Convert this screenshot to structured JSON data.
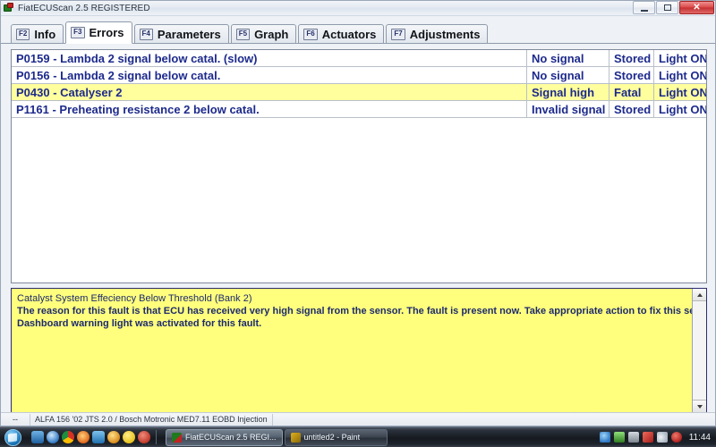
{
  "window": {
    "title": "FiatECUScan 2.5 REGISTERED",
    "icon": "app-icon",
    "buttons": {
      "minimize": "minimize-button",
      "maximize": "maximize-button",
      "close_glyph": "✕"
    }
  },
  "tabs": [
    {
      "fkey": "F2",
      "label": "Info",
      "active": false
    },
    {
      "fkey": "F3",
      "label": "Errors",
      "active": true
    },
    {
      "fkey": "F4",
      "label": "Parameters",
      "active": false
    },
    {
      "fkey": "F5",
      "label": "Graph",
      "active": false
    },
    {
      "fkey": "F6",
      "label": "Actuators",
      "active": false
    },
    {
      "fkey": "F7",
      "label": "Adjustments",
      "active": false
    }
  ],
  "errors": {
    "rows": [
      {
        "code": "P0159 - Lambda 2 signal below catal. (slow)",
        "state": "No signal",
        "severity": "Stored",
        "lamp": "Light ON",
        "selected": false
      },
      {
        "code": "P0156 - Lambda 2 signal below catal.",
        "state": "No signal",
        "severity": "Stored",
        "lamp": "Light ON",
        "selected": false
      },
      {
        "code": "P0430 - Catalyser 2",
        "state": "Signal high",
        "severity": "Fatal",
        "lamp": "Light ON",
        "selected": true
      },
      {
        "code": "P1161 - Preheating resistance 2 below catal.",
        "state": "Invalid signal",
        "severity": "Stored",
        "lamp": "Light ON",
        "selected": false
      }
    ]
  },
  "description": {
    "lines": [
      "Catalyst System Effeciency Below Threshold (Bank 2)",
      "The reason for this fault is that ECU has received very high signal from the sensor. The fault is present now. Take appropriate action to fix this sensor fault.",
      "Dashboard warning light was activated for this fault."
    ],
    "scrollbar": {
      "up": "scroll-up-arrow",
      "down": "scroll-down-arrow"
    }
  },
  "statusbar": {
    "left": "--",
    "vehicle": "ALFA 156 '02 JTS 2.0 / Bosch Motronic MED7.11 EOBD Injection"
  },
  "taskbar": {
    "start": "start-orb",
    "quicklaunch": [
      {
        "name": "show-desktop-icon",
        "color": "#3f86c9"
      },
      {
        "name": "internet-explorer-icon",
        "color": "#2f78c4"
      },
      {
        "name": "chrome-icon",
        "color": "#d93025"
      },
      {
        "name": "firefox-icon",
        "color": "#e0651a"
      },
      {
        "name": "media-player-icon",
        "color": "#2c8fd6"
      },
      {
        "name": "utorrent-icon",
        "color": "#d98b1a"
      },
      {
        "name": "smiley-icon",
        "color": "#e8c21c"
      },
      {
        "name": "shield-icon",
        "color": "#c0392b"
      }
    ],
    "tasks": [
      {
        "label": "FiatECUScan 2.5 REGI...",
        "icon_color": "#1f7a1f",
        "active": true
      },
      {
        "label": "untitled2 - Paint",
        "icon_color": "#e0b01a",
        "active": false
      }
    ],
    "tray": [
      {
        "name": "network-icon",
        "color": "#3f86c9"
      },
      {
        "name": "battery-icon",
        "color": "#4fa83d"
      },
      {
        "name": "printer-icon",
        "color": "#9aa3ad"
      },
      {
        "name": "antivirus-icon",
        "color": "#cf2a2a"
      },
      {
        "name": "volume-icon",
        "color": "#cfd6de"
      },
      {
        "name": "action-center-icon",
        "color": "#cf2a2a"
      }
    ],
    "clock": "11:44"
  },
  "colors": {
    "highlight": "#ffff9e",
    "desc_bg": "#ffff7d",
    "text_blue": "#1d2a8c",
    "desc_border": "#2d2d6e"
  }
}
